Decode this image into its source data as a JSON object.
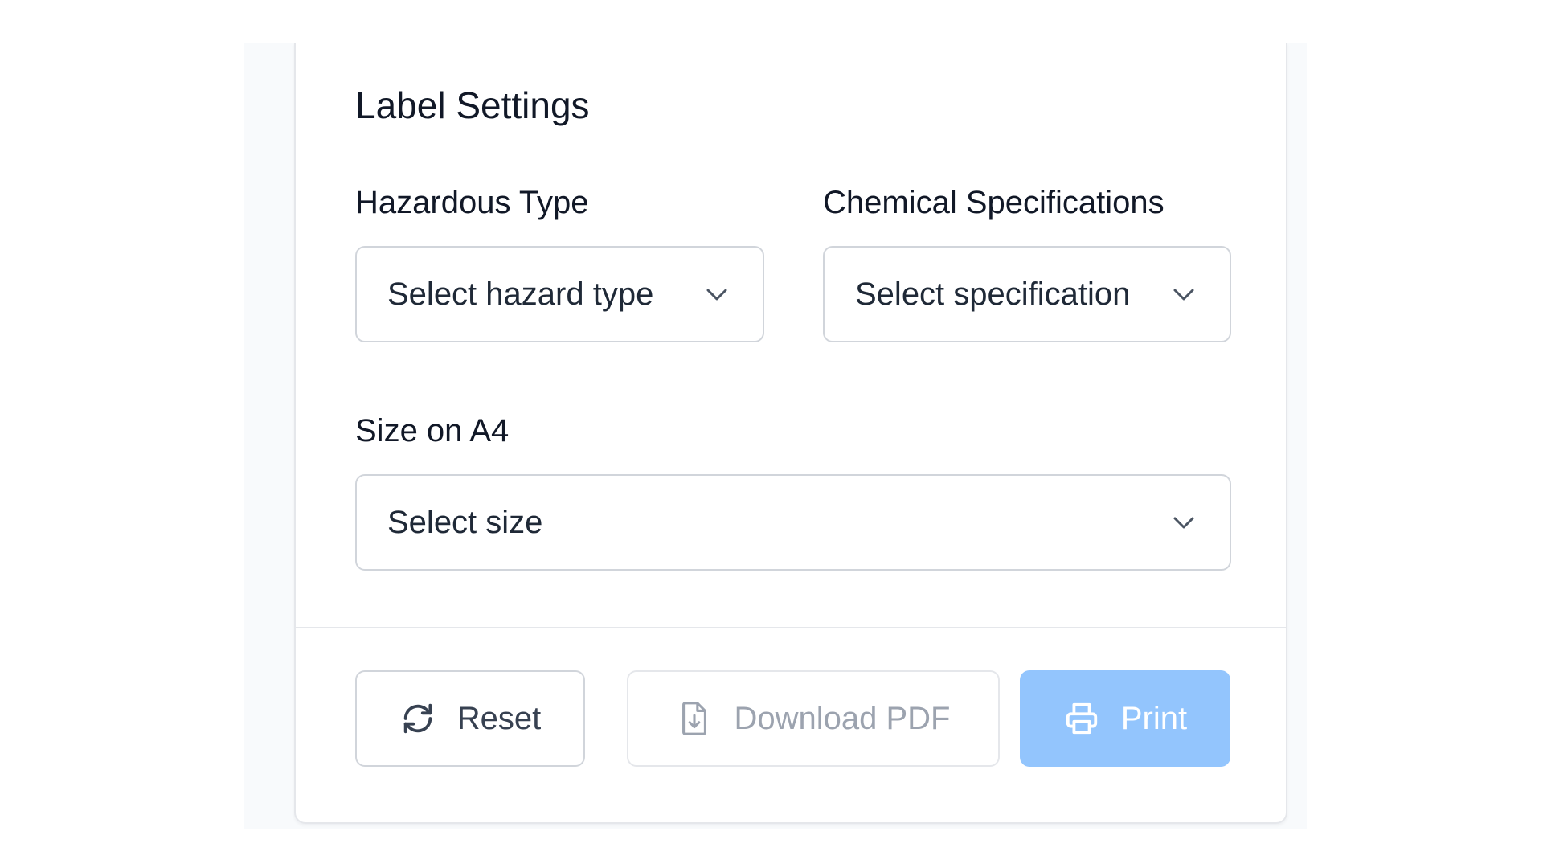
{
  "card": {
    "title": "Label Settings"
  },
  "fields": {
    "hazard_type": {
      "label": "Hazardous Type",
      "value": "Select hazard type"
    },
    "chemical_spec": {
      "label": "Chemical Specifications",
      "value": "Select specification"
    },
    "size": {
      "label": "Size on A4",
      "value": "Select size"
    }
  },
  "actions": {
    "reset_label": "Reset",
    "download_label": "Download PDF",
    "print_label": "Print"
  },
  "icons": {
    "reset": "refresh-icon",
    "download": "file-download-icon",
    "print": "printer-icon",
    "dropdown": "chevron-down-icon"
  },
  "colors": {
    "primary_disabled": "#93c5fd",
    "border": "#d1d5db",
    "muted_text": "#9ca3af"
  }
}
